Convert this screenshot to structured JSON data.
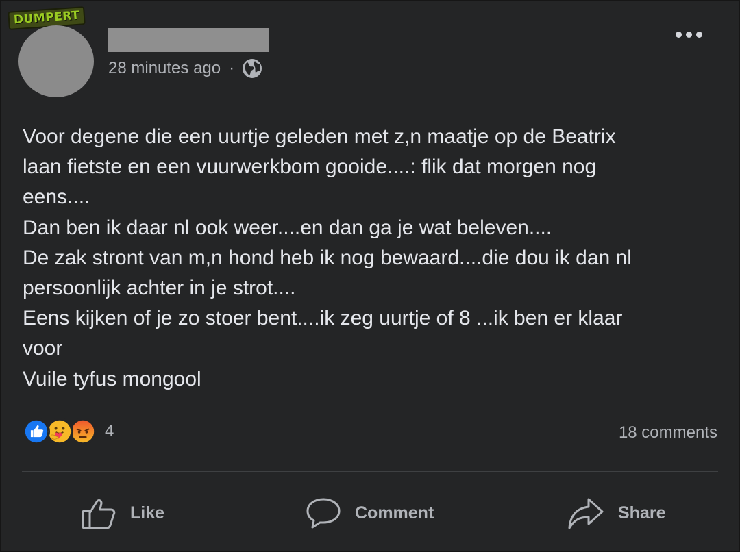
{
  "watermark": {
    "text": "DUMPERT"
  },
  "post": {
    "timestamp": "28 minutes ago",
    "separator": "·",
    "privacy_icon": "globe-icon",
    "more_icon": "more-dots-icon",
    "text": "Voor degene die een uurtje geleden met z,n maatje op de Beatrix\nlaan fietste en een vuurwerkbom gooide....: flik dat morgen nog\neens....\nDan ben ik daar nl ook weer....en dan ga je wat beleven....\nDe zak stront van m,n hond heb ik nog bewaard....die dou ik dan nl\npersoonlijk achter in je strot....\nEens kijken of je zo stoer bent....ik zeg uurtje of 8 ...ik ben er klaar\nvoor\nVuile tyfus mongool"
  },
  "engagement": {
    "reactions": [
      "like-reaction-icon",
      "care-reaction-icon",
      "angry-reaction-icon"
    ],
    "reaction_count": "4",
    "comments": "18 comments"
  },
  "actions": {
    "like": {
      "label": "Like",
      "icon": "thumbs-up-icon"
    },
    "comment": {
      "label": "Comment",
      "icon": "speech-bubble-icon"
    },
    "share": {
      "label": "Share",
      "icon": "share-arrow-icon"
    }
  },
  "colors": {
    "background": "#242526",
    "text_primary": "#e4e6eb",
    "text_secondary": "#b0b3b8",
    "like_blue": "#1877f2",
    "angry_orange": "#f0592d",
    "care_yellow": "#f7b928",
    "watermark_green": "#9acb22"
  }
}
